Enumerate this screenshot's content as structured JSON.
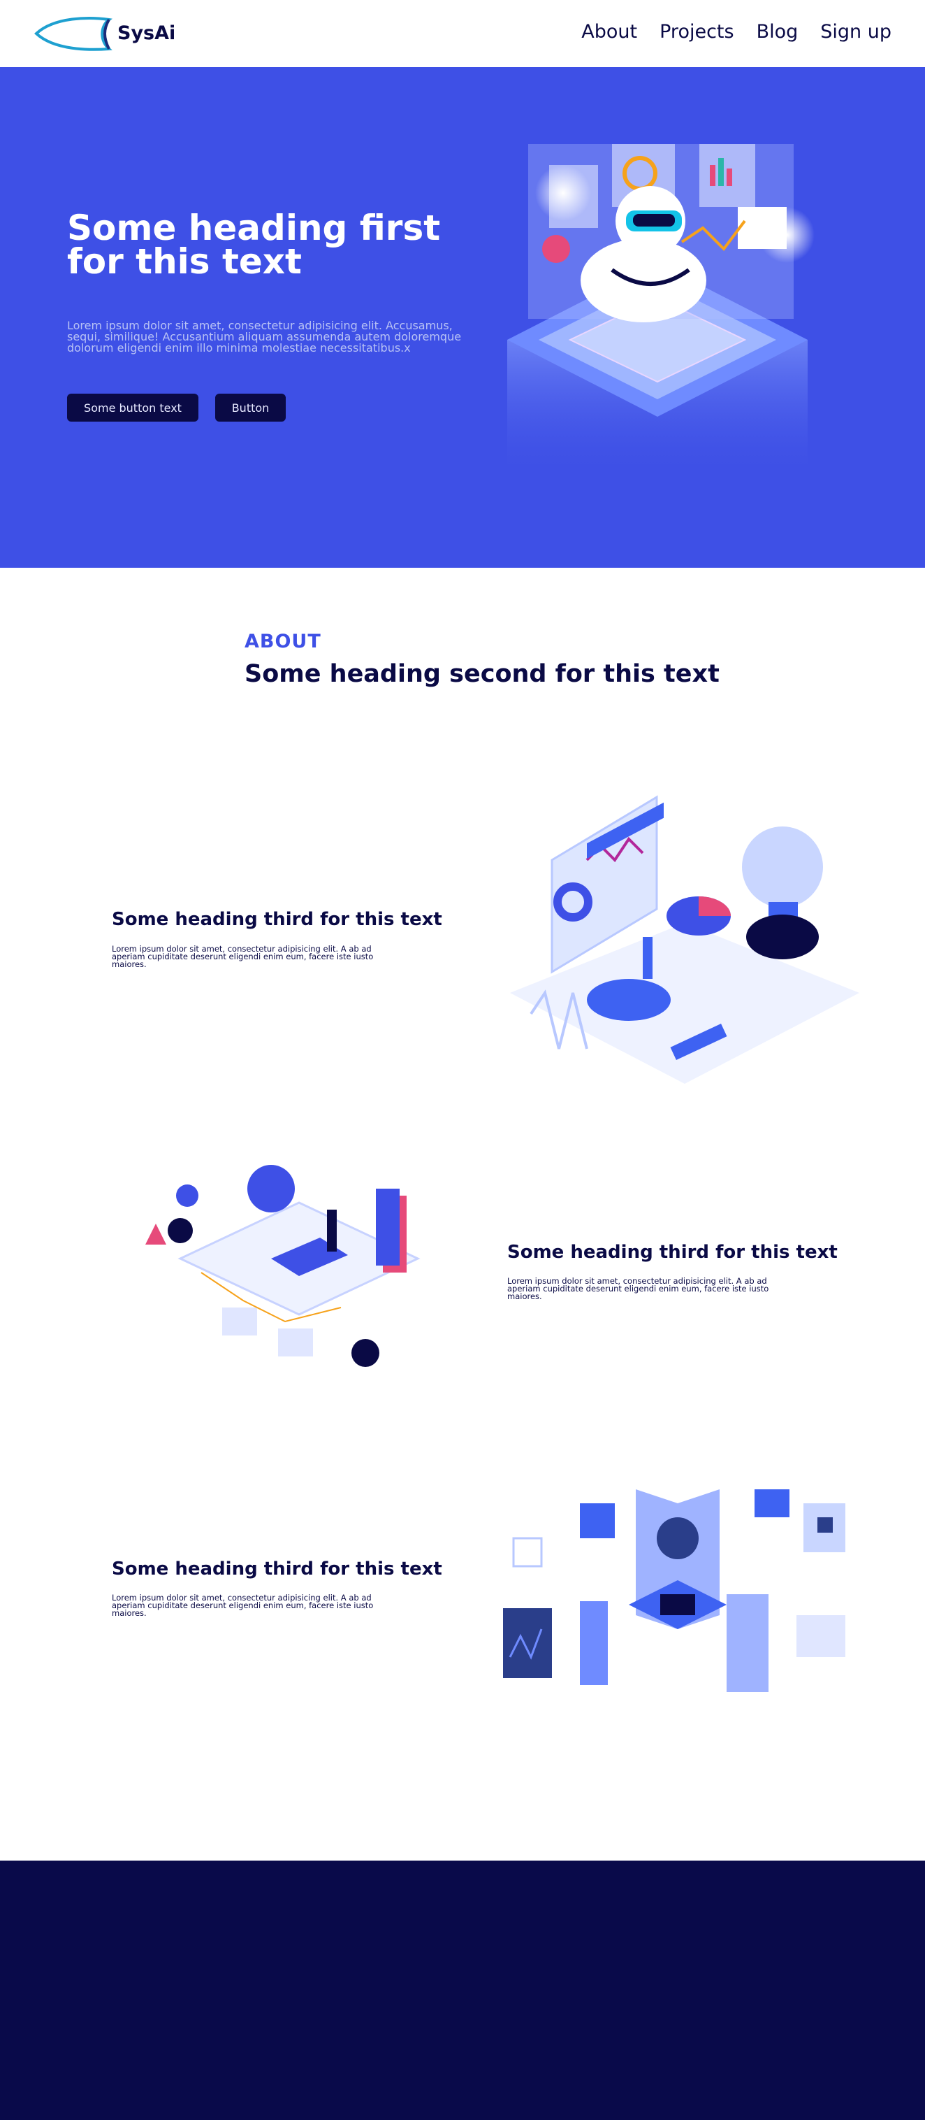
{
  "nav": {
    "brand": "SysAi",
    "links": [
      "About",
      "Projects",
      "Blog",
      "Sign up"
    ]
  },
  "hero": {
    "title": "Some heading first for this text",
    "text": "Lorem ipsum dolor sit amet, consectetur adipisicing elit. Accusamus, sequi, similique! Accusantium aliquam assumenda autem doloremque dolorum eligendi enim illo minima molestiae necessitatibus.x",
    "button_primary": "Some button text",
    "button_secondary": "Button"
  },
  "about": {
    "label": "ABOUT",
    "heading": "Some heading second for this text"
  },
  "features": [
    {
      "title": "Some heading third for this text",
      "text": "Lorem ipsum dolor sit amet, consectetur adipisicing elit. A ab ad aperiam cupiditate deserunt eligendi enim eum, facere iste iusto maiores."
    },
    {
      "title": "Some heading third for this text",
      "text": "Lorem ipsum dolor sit amet, consectetur adipisicing elit. A ab ad aperiam cupiditate deserunt eligendi enim eum, facere iste iusto maiores."
    },
    {
      "title": "Some heading third for this text",
      "text": "Lorem ipsum dolor sit amet, consectetur adipisicing elit. A ab ad aperiam cupiditate deserunt eligendi enim eum, facere iste iusto maiores."
    }
  ],
  "colors": {
    "brand_blue": "#3e50e6",
    "navy": "#0a0a45",
    "footer": "#090a4a"
  },
  "icons": [
    "fish-logo-icon",
    "robot-illustration",
    "analytics-illustration",
    "education-illustration",
    "network-illustration"
  ]
}
